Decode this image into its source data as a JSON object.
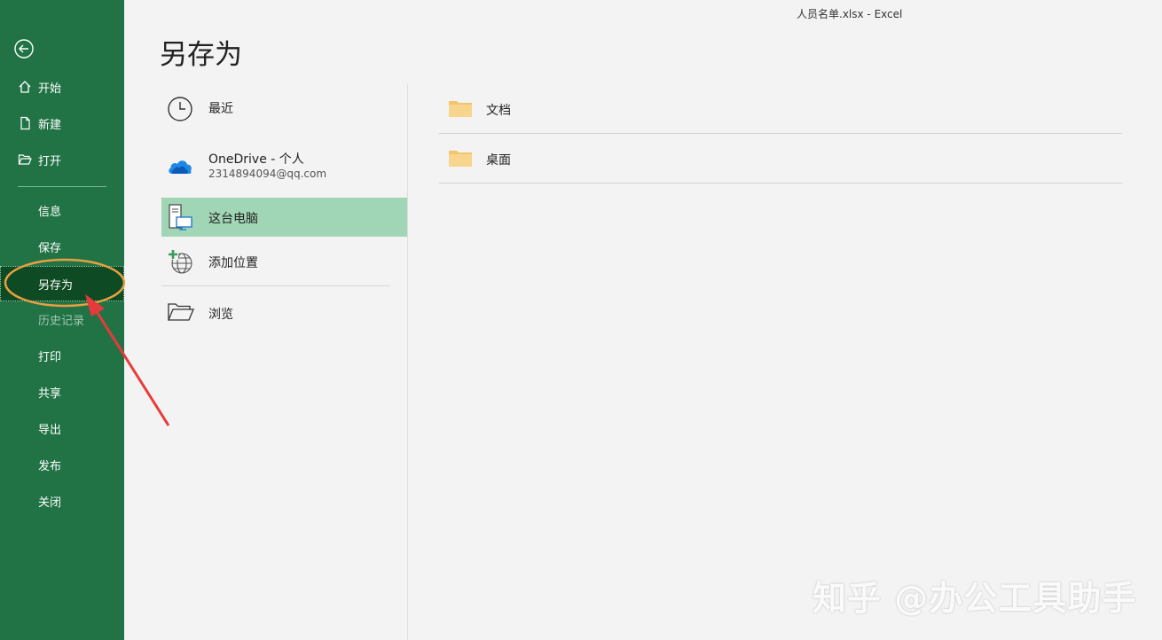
{
  "window": {
    "title": "人员名单.xlsx  -  Excel"
  },
  "sidebar": {
    "back_icon": "back-arrow-icon",
    "items": [
      {
        "label": "开始",
        "icon": "home-icon"
      },
      {
        "label": "新建",
        "icon": "new-file-icon"
      },
      {
        "label": "打开",
        "icon": "open-folder-icon"
      },
      {
        "label": "信息"
      },
      {
        "label": "保存"
      },
      {
        "label": "另存为",
        "state": "active"
      },
      {
        "label": "历史记录",
        "state": "disabled"
      },
      {
        "label": "打印"
      },
      {
        "label": "共享"
      },
      {
        "label": "导出"
      },
      {
        "label": "发布"
      },
      {
        "label": "关闭"
      }
    ]
  },
  "page": {
    "title": "另存为"
  },
  "locations": [
    {
      "label": "最近",
      "icon": "clock-icon"
    },
    {
      "label": "OneDrive - 个人",
      "sublabel": "2314894094@qq.com",
      "icon": "onedrive-cloud-icon"
    },
    {
      "label": "这台电脑",
      "icon": "this-pc-icon",
      "state": "selected"
    },
    {
      "label": "添加位置",
      "icon": "add-location-globe-icon"
    },
    {
      "label": "浏览",
      "icon": "browse-folder-icon"
    }
  ],
  "folders": [
    {
      "name": "文档",
      "icon": "folder-icon"
    },
    {
      "name": "桌面",
      "icon": "folder-icon"
    }
  ],
  "watermark": "知乎 @办公工具助手",
  "colors": {
    "sidebar_bg": "#217346",
    "active_bg": "#0e4a23",
    "selected_bg": "#a0d6b6",
    "highlight_ring": "#e8a040",
    "arrow": "#e83a3a"
  }
}
